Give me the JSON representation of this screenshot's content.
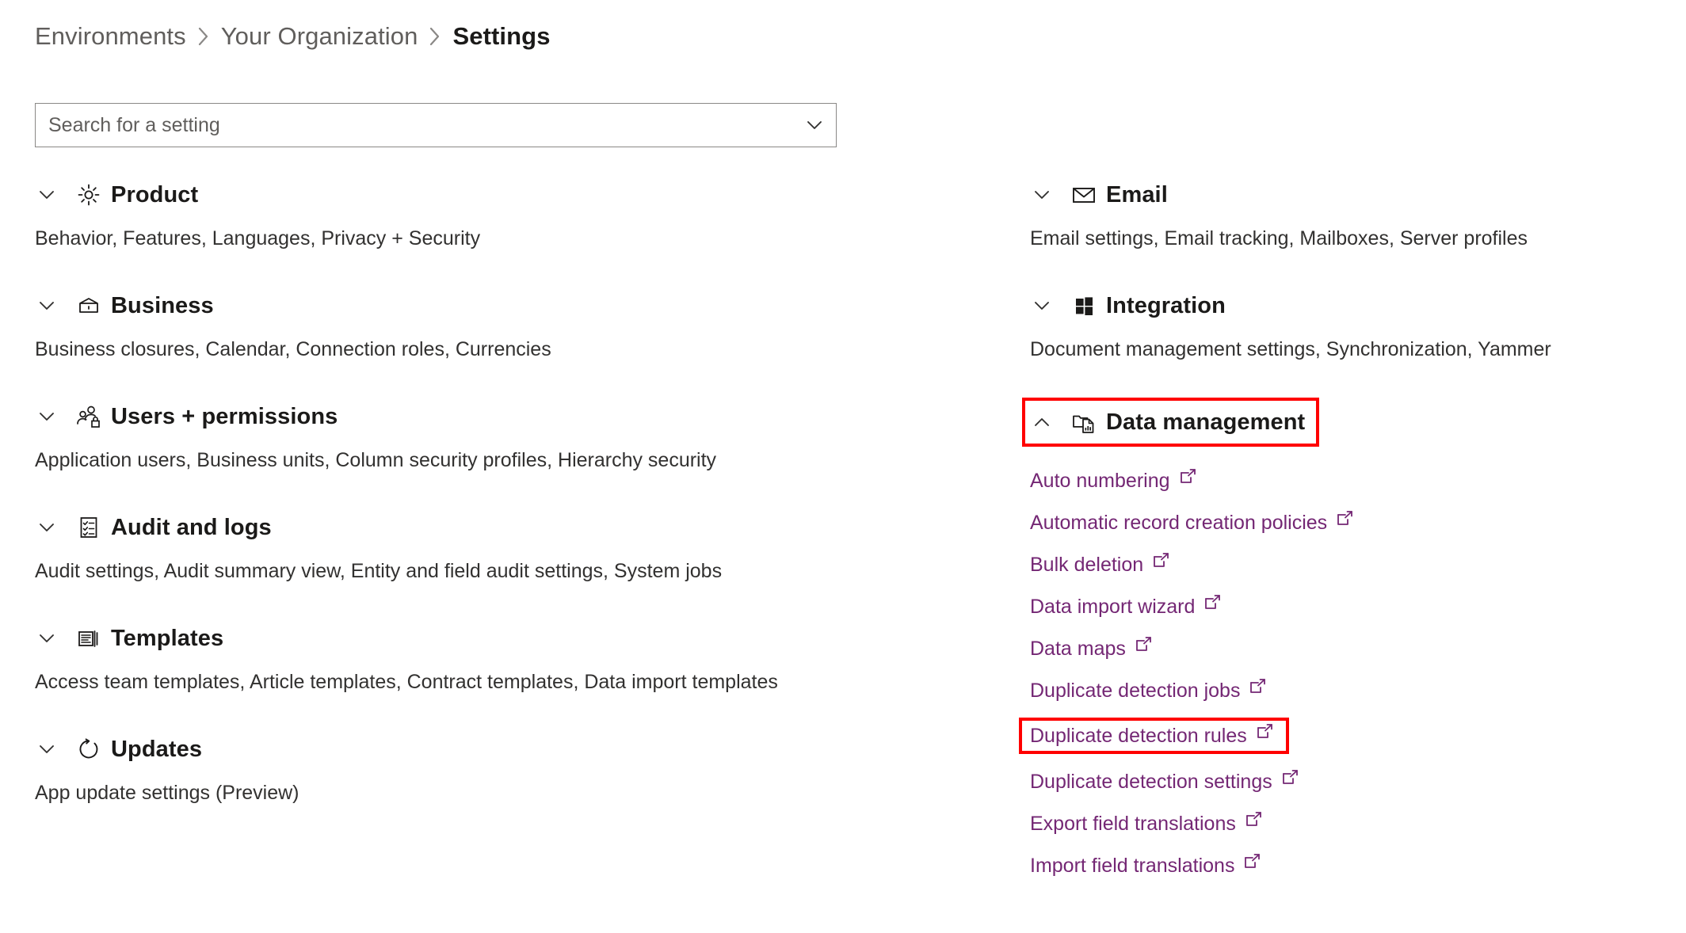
{
  "breadcrumb": {
    "items": [
      {
        "label": "Environments",
        "current": false
      },
      {
        "label": "Your Organization",
        "current": false
      },
      {
        "label": "Settings",
        "current": true
      }
    ],
    "separator_icon": "chevron-right-icon"
  },
  "search": {
    "placeholder": "Search for a setting",
    "value": "",
    "chevron_icon": "chevron-down-icon"
  },
  "colors": {
    "link": "#742774",
    "highlight": "#ff0000",
    "heading": "#1b1a19",
    "body": "#323130",
    "muted": "#605e5c",
    "border": "#8a8886"
  },
  "left_column": {
    "groups": [
      {
        "title": "Product",
        "icon": "gear-icon",
        "expanded": false,
        "toggle_icon": "chevron-down-icon",
        "description": "Behavior, Features, Languages, Privacy + Security"
      },
      {
        "title": "Business",
        "icon": "briefcase-icon",
        "expanded": false,
        "toggle_icon": "chevron-down-icon",
        "description": "Business closures, Calendar, Connection roles, Currencies"
      },
      {
        "title": "Users + permissions",
        "icon": "users-lock-icon",
        "expanded": false,
        "toggle_icon": "chevron-down-icon",
        "description": "Application users, Business units, Column security profiles, Hierarchy security"
      },
      {
        "title": "Audit and logs",
        "icon": "checklist-icon",
        "expanded": false,
        "toggle_icon": "chevron-down-icon",
        "description": "Audit settings, Audit summary view, Entity and field audit settings, System jobs"
      },
      {
        "title": "Templates",
        "icon": "documents-stack-icon",
        "expanded": false,
        "toggle_icon": "chevron-down-icon",
        "description": "Access team templates, Article templates, Contract templates, Data import templates"
      },
      {
        "title": "Updates",
        "icon": "refresh-circle-icon",
        "expanded": false,
        "toggle_icon": "chevron-down-icon",
        "description": "App update settings (Preview)"
      }
    ]
  },
  "right_column": {
    "groups": [
      {
        "title": "Email",
        "icon": "envelope-icon",
        "expanded": false,
        "toggle_icon": "chevron-down-icon",
        "description": "Email settings, Email tracking, Mailboxes, Server profiles"
      },
      {
        "title": "Integration",
        "icon": "windows-grid-icon",
        "expanded": false,
        "toggle_icon": "chevron-down-icon",
        "description": "Document management settings, Synchronization, Yammer"
      }
    ],
    "data_management": {
      "title": "Data management",
      "icon": "folder-chart-icon",
      "expanded": true,
      "toggle_icon": "chevron-up-icon",
      "highlighted": true,
      "links": [
        {
          "label": "Auto numbering",
          "icon": "external-link-icon",
          "highlighted": false
        },
        {
          "label": "Automatic record creation policies",
          "icon": "external-link-icon",
          "highlighted": false
        },
        {
          "label": "Bulk deletion",
          "icon": "external-link-icon",
          "highlighted": false
        },
        {
          "label": "Data import wizard",
          "icon": "external-link-icon",
          "highlighted": false
        },
        {
          "label": "Data maps",
          "icon": "external-link-icon",
          "highlighted": false
        },
        {
          "label": "Duplicate detection jobs",
          "icon": "external-link-icon",
          "highlighted": false
        },
        {
          "label": "Duplicate detection rules",
          "icon": "external-link-icon",
          "highlighted": true
        },
        {
          "label": "Duplicate detection settings",
          "icon": "external-link-icon",
          "highlighted": false
        },
        {
          "label": "Export field translations",
          "icon": "external-link-icon",
          "highlighted": false
        },
        {
          "label": "Import field translations",
          "icon": "external-link-icon",
          "highlighted": false
        }
      ]
    }
  }
}
